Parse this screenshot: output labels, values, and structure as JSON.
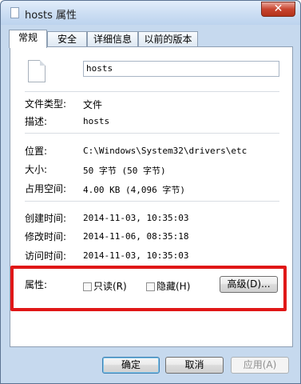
{
  "window": {
    "title": "hosts 属性",
    "close_label": "✕"
  },
  "tabs": [
    {
      "label": "常规",
      "active": true
    },
    {
      "label": "安全",
      "active": false
    },
    {
      "label": "详细信息",
      "active": false
    },
    {
      "label": "以前的版本",
      "active": false
    }
  ],
  "general": {
    "file_name": "hosts",
    "file_icon": "document-icon",
    "file_type_label": "文件类型:",
    "file_type_value": "文件",
    "description_label": "描述:",
    "description_value": "hosts",
    "location_label": "位置:",
    "location_value": "C:\\Windows\\System32\\drivers\\etc",
    "size_label": "大小:",
    "size_value": "50 字节 (50 字节)",
    "size_on_disk_label": "占用空间:",
    "size_on_disk_value": "4.00 KB (4,096 字节)",
    "created_label": "创建时间:",
    "created_value": "2014-11-03, 10:35:03",
    "modified_label": "修改时间:",
    "modified_value": "2014-11-06, 08:35:18",
    "accessed_label": "访问时间:",
    "accessed_value": "2014-11-03, 10:35:03",
    "attributes_label": "属性:",
    "readonly_label": "只读(R)",
    "readonly_checked": false,
    "hidden_label": "隐藏(H)",
    "hidden_checked": false,
    "advanced_label": "高级(D)..."
  },
  "footer": {
    "ok_label": "确定",
    "cancel_label": "取消",
    "apply_label": "应用(A)"
  },
  "colors": {
    "highlight_border": "#e01717",
    "window_frame": "#c6d9ee"
  }
}
